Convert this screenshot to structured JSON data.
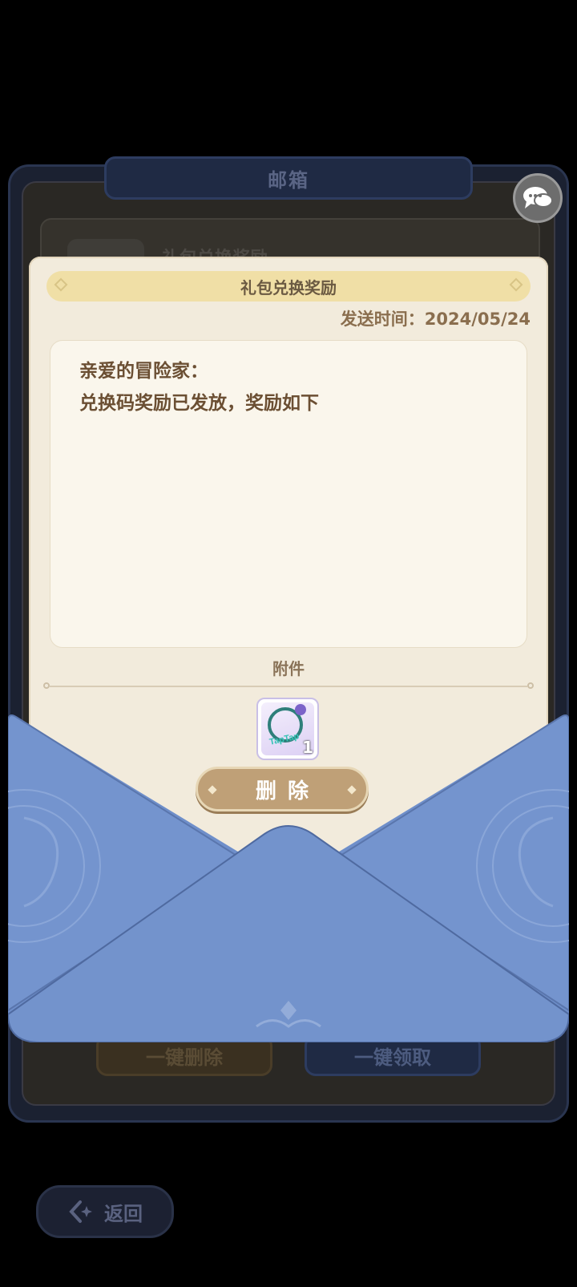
{
  "mailbox": {
    "title": "邮箱",
    "list_item_title": "礼包兑换奖励",
    "delete_all_label": "一键删除",
    "claim_all_label": "一键领取",
    "back_label": "返回"
  },
  "letter": {
    "title": "礼包兑换奖励",
    "send_time": "发送时间：2024/05/24",
    "greeting": "亲爱的冒险家：",
    "message": "兑换码奖励已发放，奖励如下",
    "attachments_label": "附件",
    "attachment": {
      "brand_text": "TapTap",
      "quantity": "1"
    },
    "delete_label": "删除"
  },
  "colors": {
    "envelope": "#7393cc",
    "letter_bg": "#f2ebdc",
    "title_bar": "#f0dfa6",
    "delete_button": "#bfa077"
  }
}
